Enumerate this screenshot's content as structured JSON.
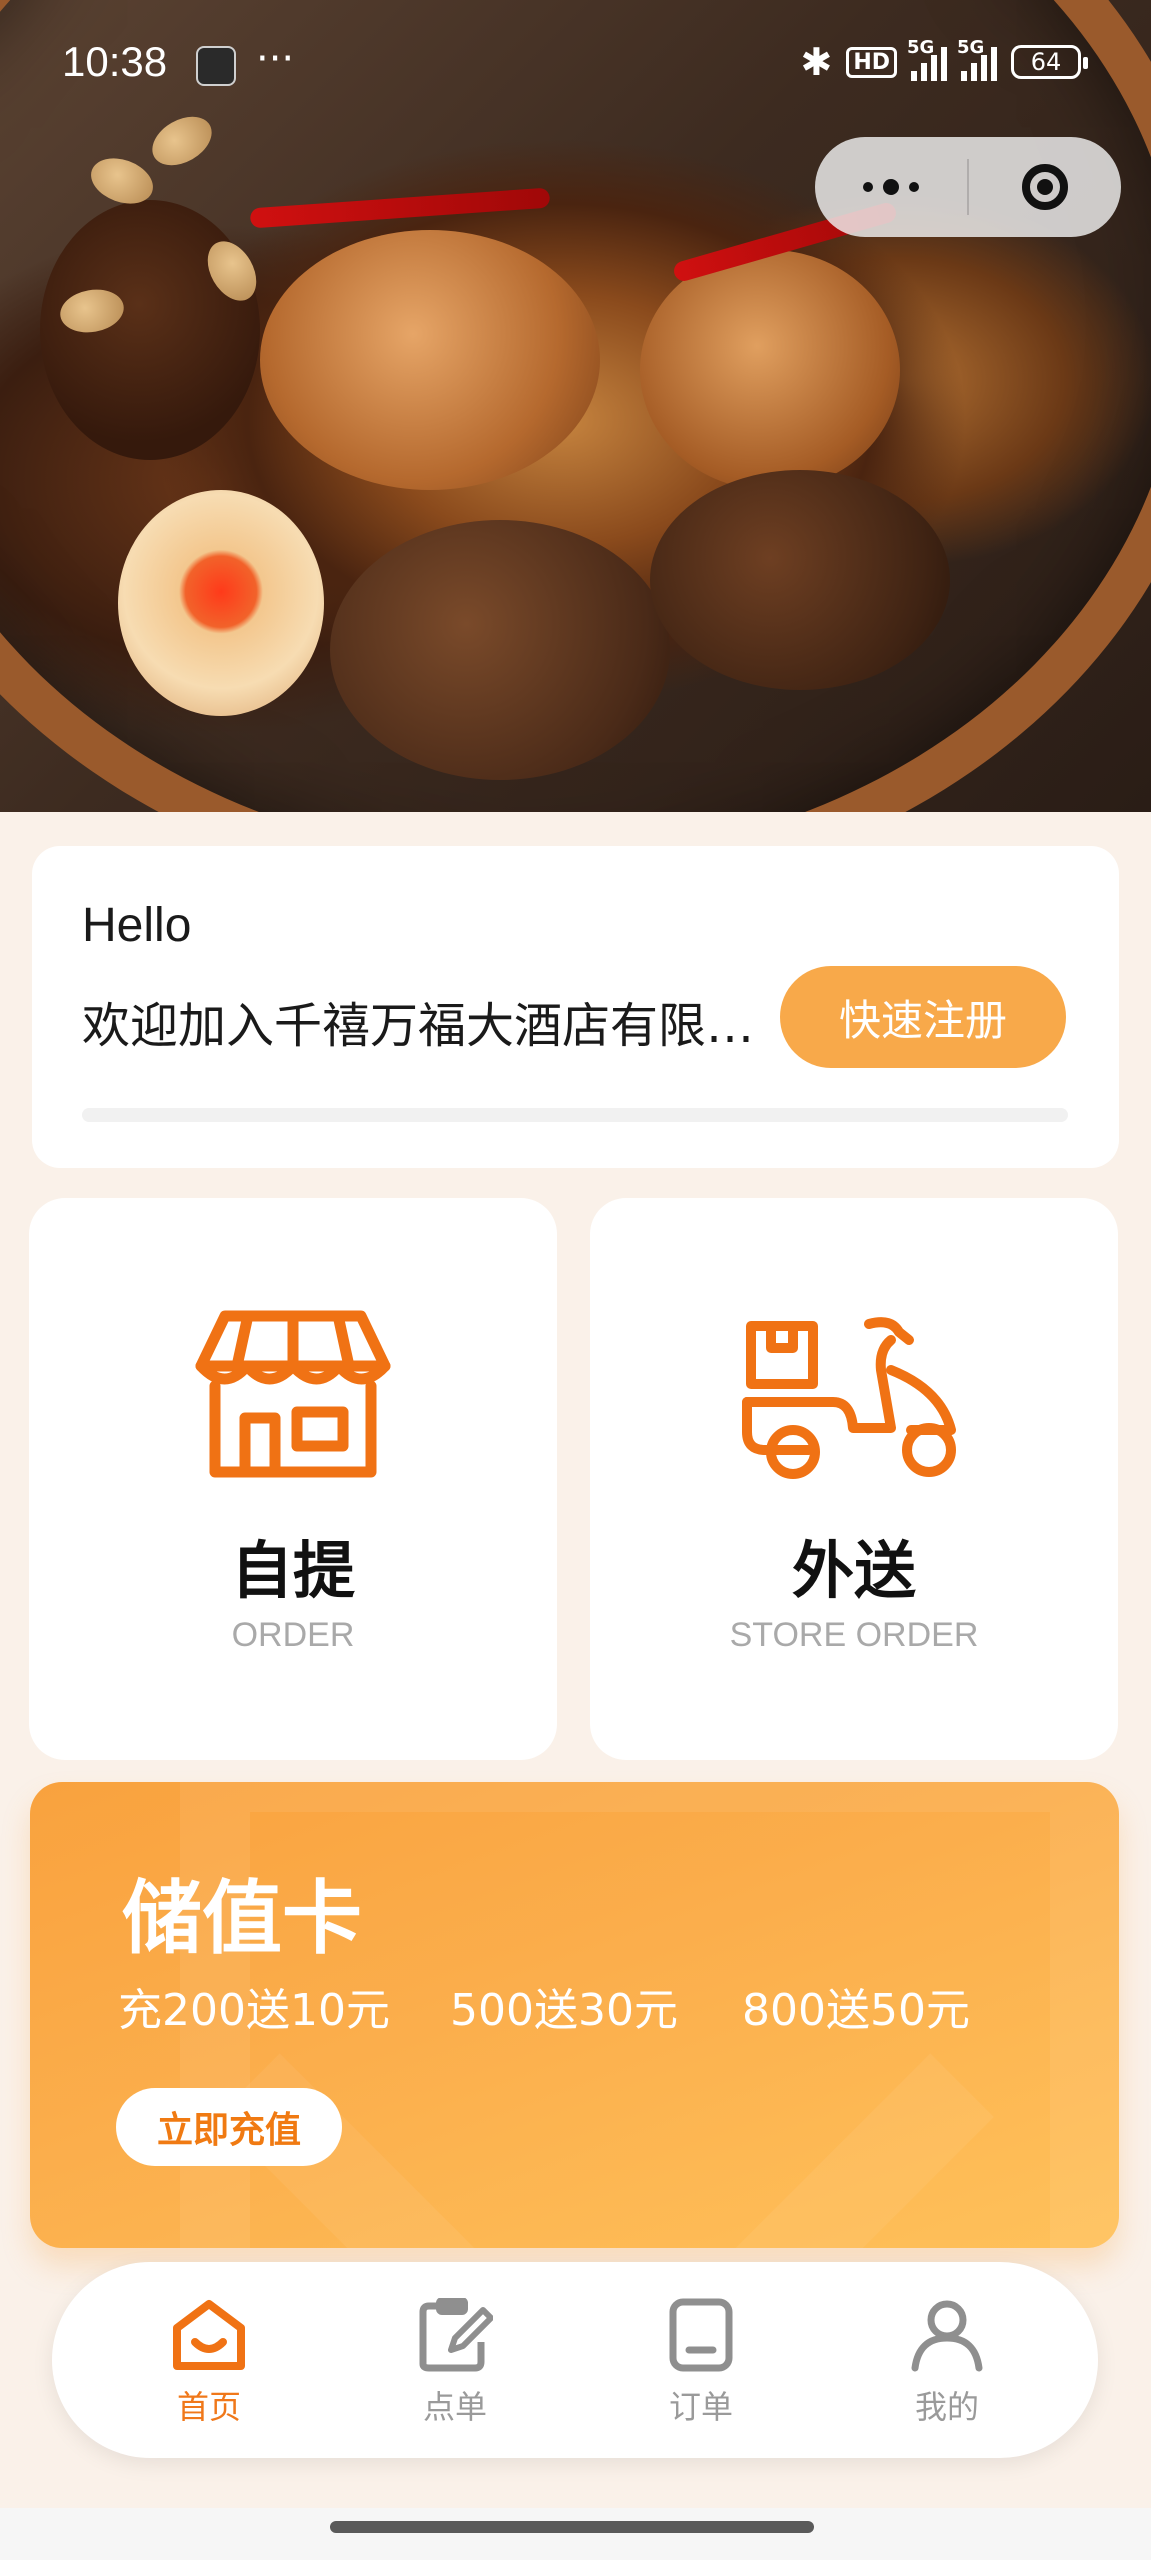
{
  "status_bar": {
    "time": "10:38",
    "hd_label": "HD",
    "signal1_label": "5G",
    "signal2_label": "5G",
    "battery": "64"
  },
  "welcome": {
    "greeting": "Hello",
    "message": "欢迎加入千禧万福大酒店有限公司",
    "register_label": "快速注册"
  },
  "services": [
    {
      "title": "自提",
      "subtitle": "ORDER",
      "icon": "store-icon"
    },
    {
      "title": "外送",
      "subtitle": "STORE ORDER",
      "icon": "delivery-scooter-icon"
    }
  ],
  "stored_value": {
    "title": "储值卡",
    "offers": [
      "充200送10元",
      "500送30元",
      "800送50元"
    ],
    "recharge_label": "立即充值"
  },
  "tabbar": {
    "items": [
      {
        "label": "首页",
        "icon": "home-icon",
        "active": true
      },
      {
        "label": "点单",
        "icon": "order-menu-icon",
        "active": false
      },
      {
        "label": "订单",
        "icon": "orders-icon",
        "active": false
      },
      {
        "label": "我的",
        "icon": "profile-icon",
        "active": false
      }
    ]
  },
  "colors": {
    "accent": "#f07a12",
    "register_button": "#f8a94a",
    "card_gradient_start": "#f9a23e",
    "card_gradient_end": "#ffc15a",
    "page_background": "#faf1e9",
    "inactive_tab": "#9a9a9a"
  }
}
